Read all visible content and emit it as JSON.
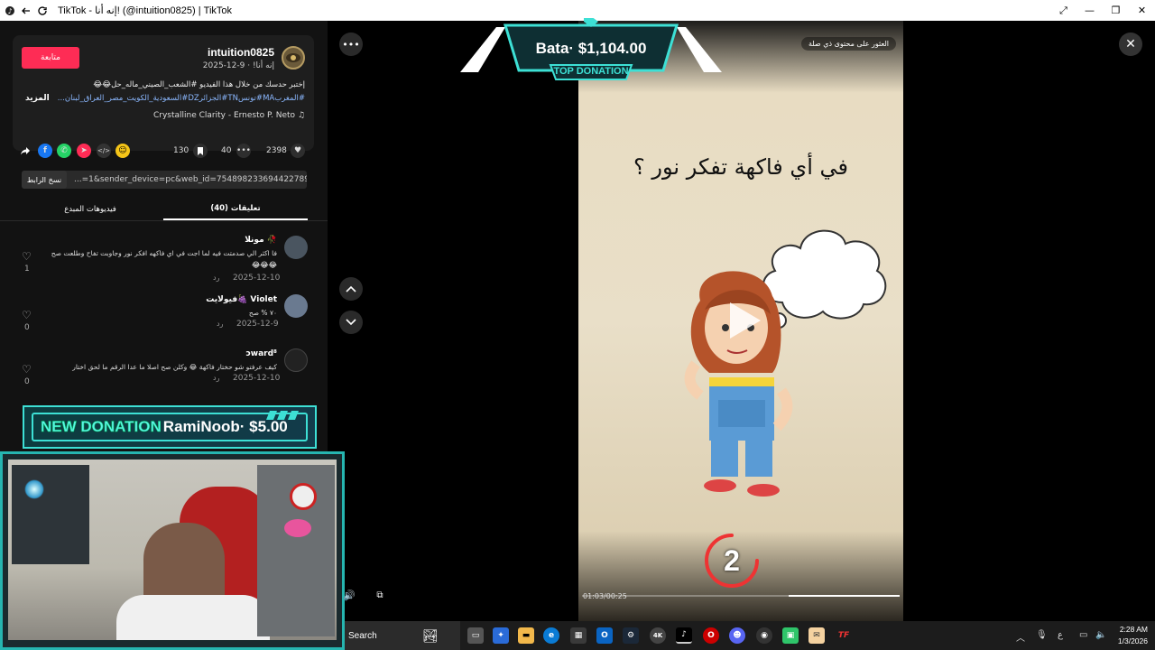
{
  "window": {
    "title": "TikTok - إنه أنا! (@intuition0825) | TikTok"
  },
  "post": {
    "follow_label": "متابعة",
    "username": "intuition0825",
    "date_line": "إنه أنا! · 9-12-2025",
    "description_line1": "إختبر حدسك من خلال هذا الفيديو #الشعب_الصيني_ماله_حل😂😂",
    "description_line2": "#المغربMA#تونسTN#الجزائرDZ#السعودية_الكويت_مصر_العراق_لبنان...",
    "more_label": "المزيد",
    "music": "Crystalline Clarity - Ernesto P. Neto",
    "likes": "2398",
    "comments_count": "40",
    "saves": "130",
    "copy_link_label": "نسخ الرابط",
    "link_url": "...=1&sender_device=pc&web_id=7548982336944227896"
  },
  "tabs": {
    "comments": "تعليقات (40)",
    "creator_videos": "فيديوهات المبدع"
  },
  "comments": [
    {
      "name": "مونلا 🥀",
      "text": "فا اكثر الي صدمتت فيه لما اجت في اي فاكهه افكر نور وجاوبت تفاح وطلعت صح",
      "text2": "😂😂😂",
      "date": "2025-12-10",
      "reply": "رد",
      "likes": "1"
    },
    {
      "name": "فيولايت🍇 Violet",
      "text": "٧٠ % صح",
      "date": "2025-12-9",
      "reply": "رد",
      "likes": "0"
    },
    {
      "name": "ɔward⁸",
      "text": "كيف عرفتو شو حختار فاكهة 😂 وكلن صح اصلا ما عدا الرقم ما لحق اختار",
      "date": "2025-12-10",
      "reply": "رد",
      "likes": "0"
    }
  ],
  "overlays": {
    "new_donation_label": "NEW DONATION",
    "new_donation_donor": "RamiNoob· $5.00",
    "top_donation_amount": "Bata· $1,104.00",
    "top_donation_label": "TOP DONATION"
  },
  "video": {
    "question": "في أي فاكهة تفكر نور ؟",
    "dim_label": "العثور على محتوى ذي صلة",
    "time": "01:03/00:25",
    "countdown": "2",
    "progress": 0.35
  },
  "taskbar": {
    "search_label": "Search",
    "time": "2:28 AM",
    "date": "1/3/2026",
    "lang": "ع"
  },
  "colors": {
    "accent": "#fe2c55",
    "donation_cyan": "#3de0d5"
  }
}
